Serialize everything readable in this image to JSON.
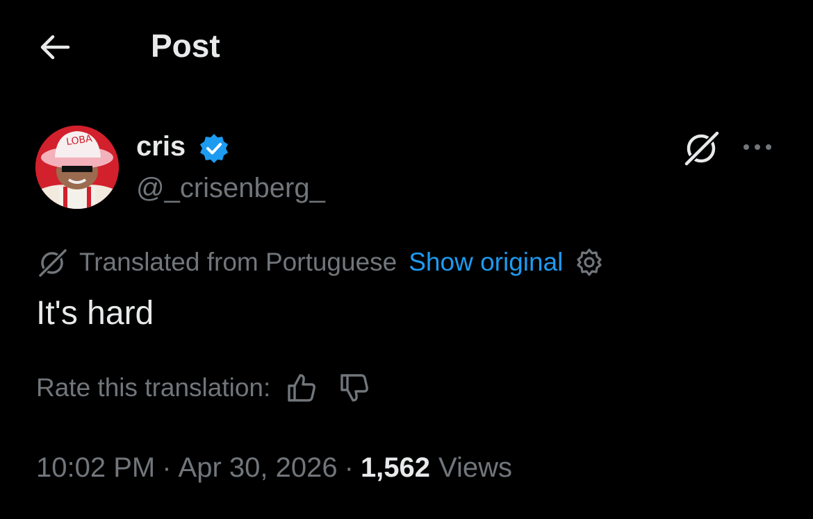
{
  "header": {
    "title": "Post",
    "back_icon": "arrow-left-icon"
  },
  "author": {
    "display_name": "cris",
    "handle": "@_crisenberg_",
    "verified": true,
    "verified_color": "#1d9bf0",
    "avatar_text": "LOBA"
  },
  "translation": {
    "label": "Translated from Portuguese",
    "show_original": "Show original"
  },
  "post": {
    "text": "It's hard"
  },
  "rating": {
    "label": "Rate this translation:"
  },
  "meta": {
    "time": "10:02 PM",
    "separator": "·",
    "date": "Apr 30, 2026",
    "views_count": "1,562",
    "views_label": "Views"
  },
  "colors": {
    "background": "#000000",
    "primary_text": "#e7e9ea",
    "secondary_text": "#71767b",
    "link": "#1d9bf0"
  }
}
